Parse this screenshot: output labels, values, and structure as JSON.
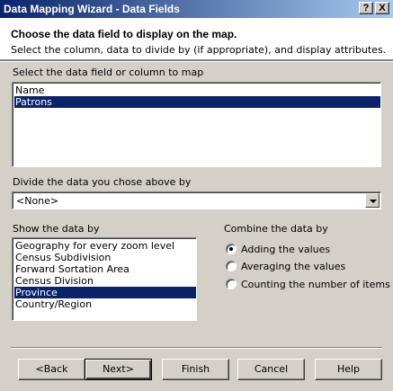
{
  "window": {
    "title": "Data Mapping Wizard - Data Fields",
    "help_label": "?",
    "close_label": "X"
  },
  "header": {
    "heading": "Choose the data field to display on the map.",
    "subheading": "Select the column, data to divide by (if appropriate), and display attributes."
  },
  "data_field": {
    "label": "Select the data field or column to map",
    "items": [
      "Name",
      "Patrons"
    ],
    "selected": "Patrons"
  },
  "divide": {
    "label": "Divide the data you chose above by",
    "value": "<None>"
  },
  "show_by": {
    "label": "Show the data by",
    "items": [
      "Geography for every zoom level",
      "Census Subdivision",
      "Forward Sortation Area",
      "Census Division",
      "Province",
      "Country/Region"
    ],
    "selected": "Province"
  },
  "combine": {
    "label": "Combine the data by",
    "options": [
      "Adding the values",
      "Averaging the values",
      "Counting the number of items"
    ],
    "selected": "Adding the values"
  },
  "buttons": {
    "back": "<Back",
    "next": "Next>",
    "finish": "Finish",
    "cancel": "Cancel",
    "help": "Help"
  }
}
